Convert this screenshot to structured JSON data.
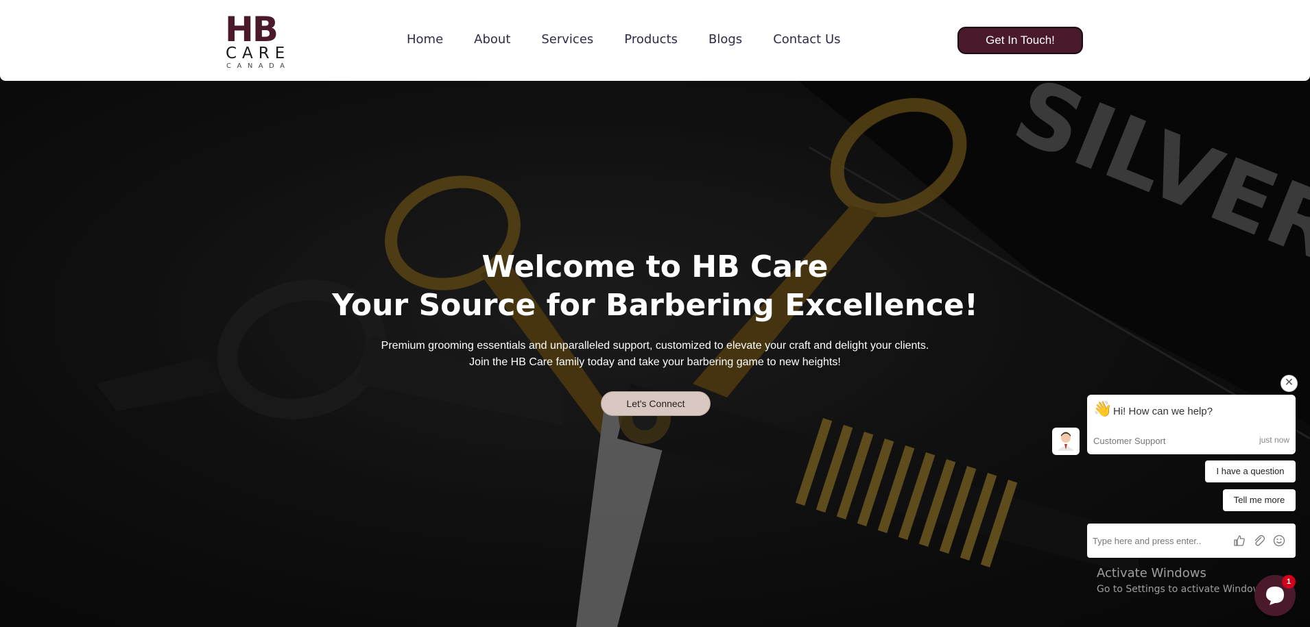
{
  "header": {
    "logo": {
      "main": "HB",
      "sub": "CARE",
      "region": "CANADA"
    },
    "nav": [
      "Home",
      "About",
      "Services",
      "Products",
      "Blogs",
      "Contact Us"
    ],
    "cta_label": "Get In Touch!"
  },
  "hero": {
    "title_line1": "Welcome to HB Care",
    "title_line2": "Your Source for Barbering Excellence!",
    "sub_line1": "Premium grooming essentials and unparalleled support, customized to elevate your craft and delight your clients.",
    "sub_line2": "Join the HB Care family today and take your barbering game to new heights!",
    "button_label": "Let's Connect",
    "background_text": "SILVER L"
  },
  "chat": {
    "greeting": "Hi! How can we help?",
    "agent": "Customer Support",
    "time": "just now",
    "quick_replies": [
      "I have a question",
      "Tell me more"
    ],
    "input_placeholder": "Type here and press enter..",
    "badge_count": "1",
    "icons": [
      "close-icon",
      "wave-emoji-icon",
      "thumbs-up-icon",
      "attachment-icon",
      "emoji-icon",
      "chat-bubble-icon"
    ],
    "accent": "#4a1a2c"
  },
  "os_overlay": {
    "title": "Activate Windows",
    "subtitle": "Go to Settings to activate Windows."
  }
}
